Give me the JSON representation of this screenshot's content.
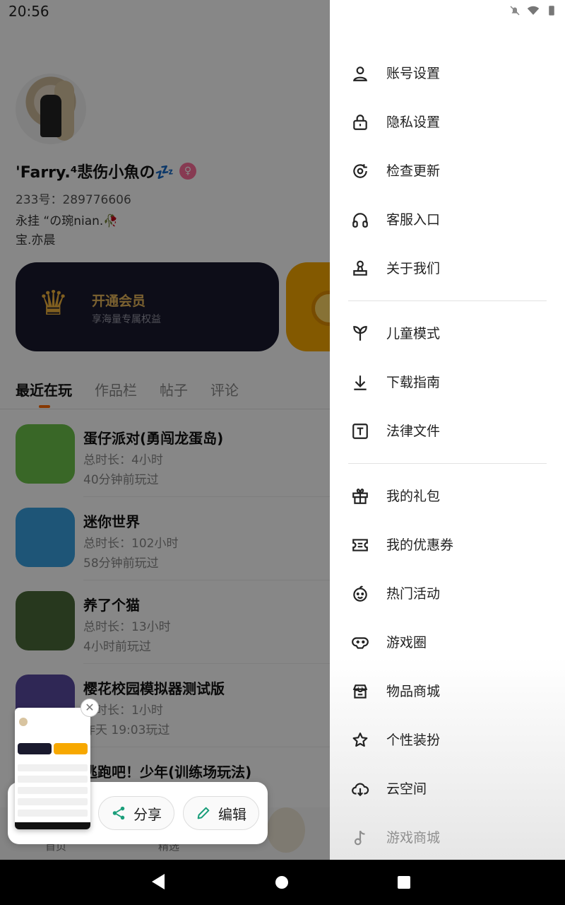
{
  "status_bar": {
    "time": "20:56"
  },
  "profile": {
    "name": "'Farry.⁴悲伤小魚の💤",
    "gender_icon": "female-icon",
    "id_text": "233号：289776606",
    "bio_line1": "永挂 “の琬nian.🥀",
    "bio_line2": "宝.亦晨"
  },
  "vip_card": {
    "title": "开通会员",
    "subtitle": "享海量专属权益",
    "icon": "crown-icon"
  },
  "tabs": [
    {
      "label": "最近在玩",
      "active": true
    },
    {
      "label": "作品栏",
      "active": false
    },
    {
      "label": "帖子",
      "active": false
    },
    {
      "label": "评论",
      "active": false
    }
  ],
  "games": [
    {
      "name": "蛋仔派对(勇闯龙蛋岛)",
      "duration": "总时长：4小时",
      "last_played": "40分钟前玩过",
      "icon_color": "#6cc24a"
    },
    {
      "name": "迷你世界",
      "duration": "总时长：102小时",
      "last_played": "58分钟前玩过",
      "icon_color": "#3aa0e0"
    },
    {
      "name": "养了个猫",
      "duration": "总时长：13小时",
      "last_played": "4小时前玩过",
      "icon_color": "#4b6a3a"
    },
    {
      "name": "樱花校园模拟器测试版",
      "duration": "总时长：1小时",
      "last_played": "昨天 19:03玩过",
      "icon_color": "#5a4aa0"
    },
    {
      "name": "逃跑吧！少年(训练场玩法)",
      "duration": "",
      "last_played": "",
      "icon_color": "#e07a2a"
    }
  ],
  "bottom_nav": {
    "home": "首页",
    "pick": "精选"
  },
  "share_popup": {
    "share_label": "分享",
    "edit_label": "编辑"
  },
  "drawer": {
    "group1": [
      {
        "label": "账号设置",
        "icon": "person-icon"
      },
      {
        "label": "隐私设置",
        "icon": "lock-icon"
      },
      {
        "label": "检查更新",
        "icon": "refresh-icon"
      },
      {
        "label": "客服入口",
        "icon": "headset-icon"
      },
      {
        "label": "关于我们",
        "icon": "stamp-icon"
      }
    ],
    "group2": [
      {
        "label": "儿童模式",
        "icon": "sprout-icon"
      },
      {
        "label": "下载指南",
        "icon": "download-icon"
      },
      {
        "label": "法律文件",
        "icon": "document-t-icon"
      }
    ],
    "group3": [
      {
        "label": "我的礼包",
        "icon": "gift-icon"
      },
      {
        "label": "我的优惠券",
        "icon": "coupon-icon"
      },
      {
        "label": "热门活动",
        "icon": "smile-icon"
      },
      {
        "label": "游戏圈",
        "icon": "gamepad-icon"
      },
      {
        "label": "物品商城",
        "icon": "store-icon"
      },
      {
        "label": "个性装扮",
        "icon": "star-icon"
      },
      {
        "label": "云空间",
        "icon": "cloud-download-icon"
      },
      {
        "label": "游戏商城",
        "icon": "music-note-icon"
      }
    ]
  }
}
